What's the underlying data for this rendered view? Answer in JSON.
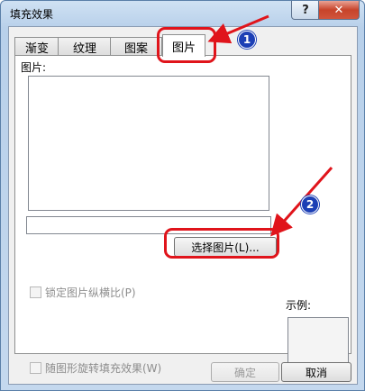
{
  "window": {
    "title": "填充效果",
    "help_label": "?",
    "close_label": "✕"
  },
  "tabs": [
    {
      "label": "渐变",
      "active": false
    },
    {
      "label": "纹理",
      "active": false
    },
    {
      "label": "图案",
      "active": false
    },
    {
      "label": "图片",
      "active": true
    }
  ],
  "picture_panel": {
    "section_label": "图片:",
    "filename_value": "",
    "select_button_label": "选择图片(L)...",
    "lock_aspect_label": "锁定图片纵横比(P)",
    "lock_aspect_checked": false,
    "sample_label": "示例:"
  },
  "rotate_with_shape_label": "随图形旋转填充效果(W)",
  "rotate_with_shape_checked": false,
  "footer": {
    "ok_label": "确定",
    "cancel_label": "取消"
  },
  "annotations": {
    "badge_1": "1",
    "badge_2": "2",
    "highlight_color": "#e0141b",
    "badge_color": "#1c3fb5"
  }
}
